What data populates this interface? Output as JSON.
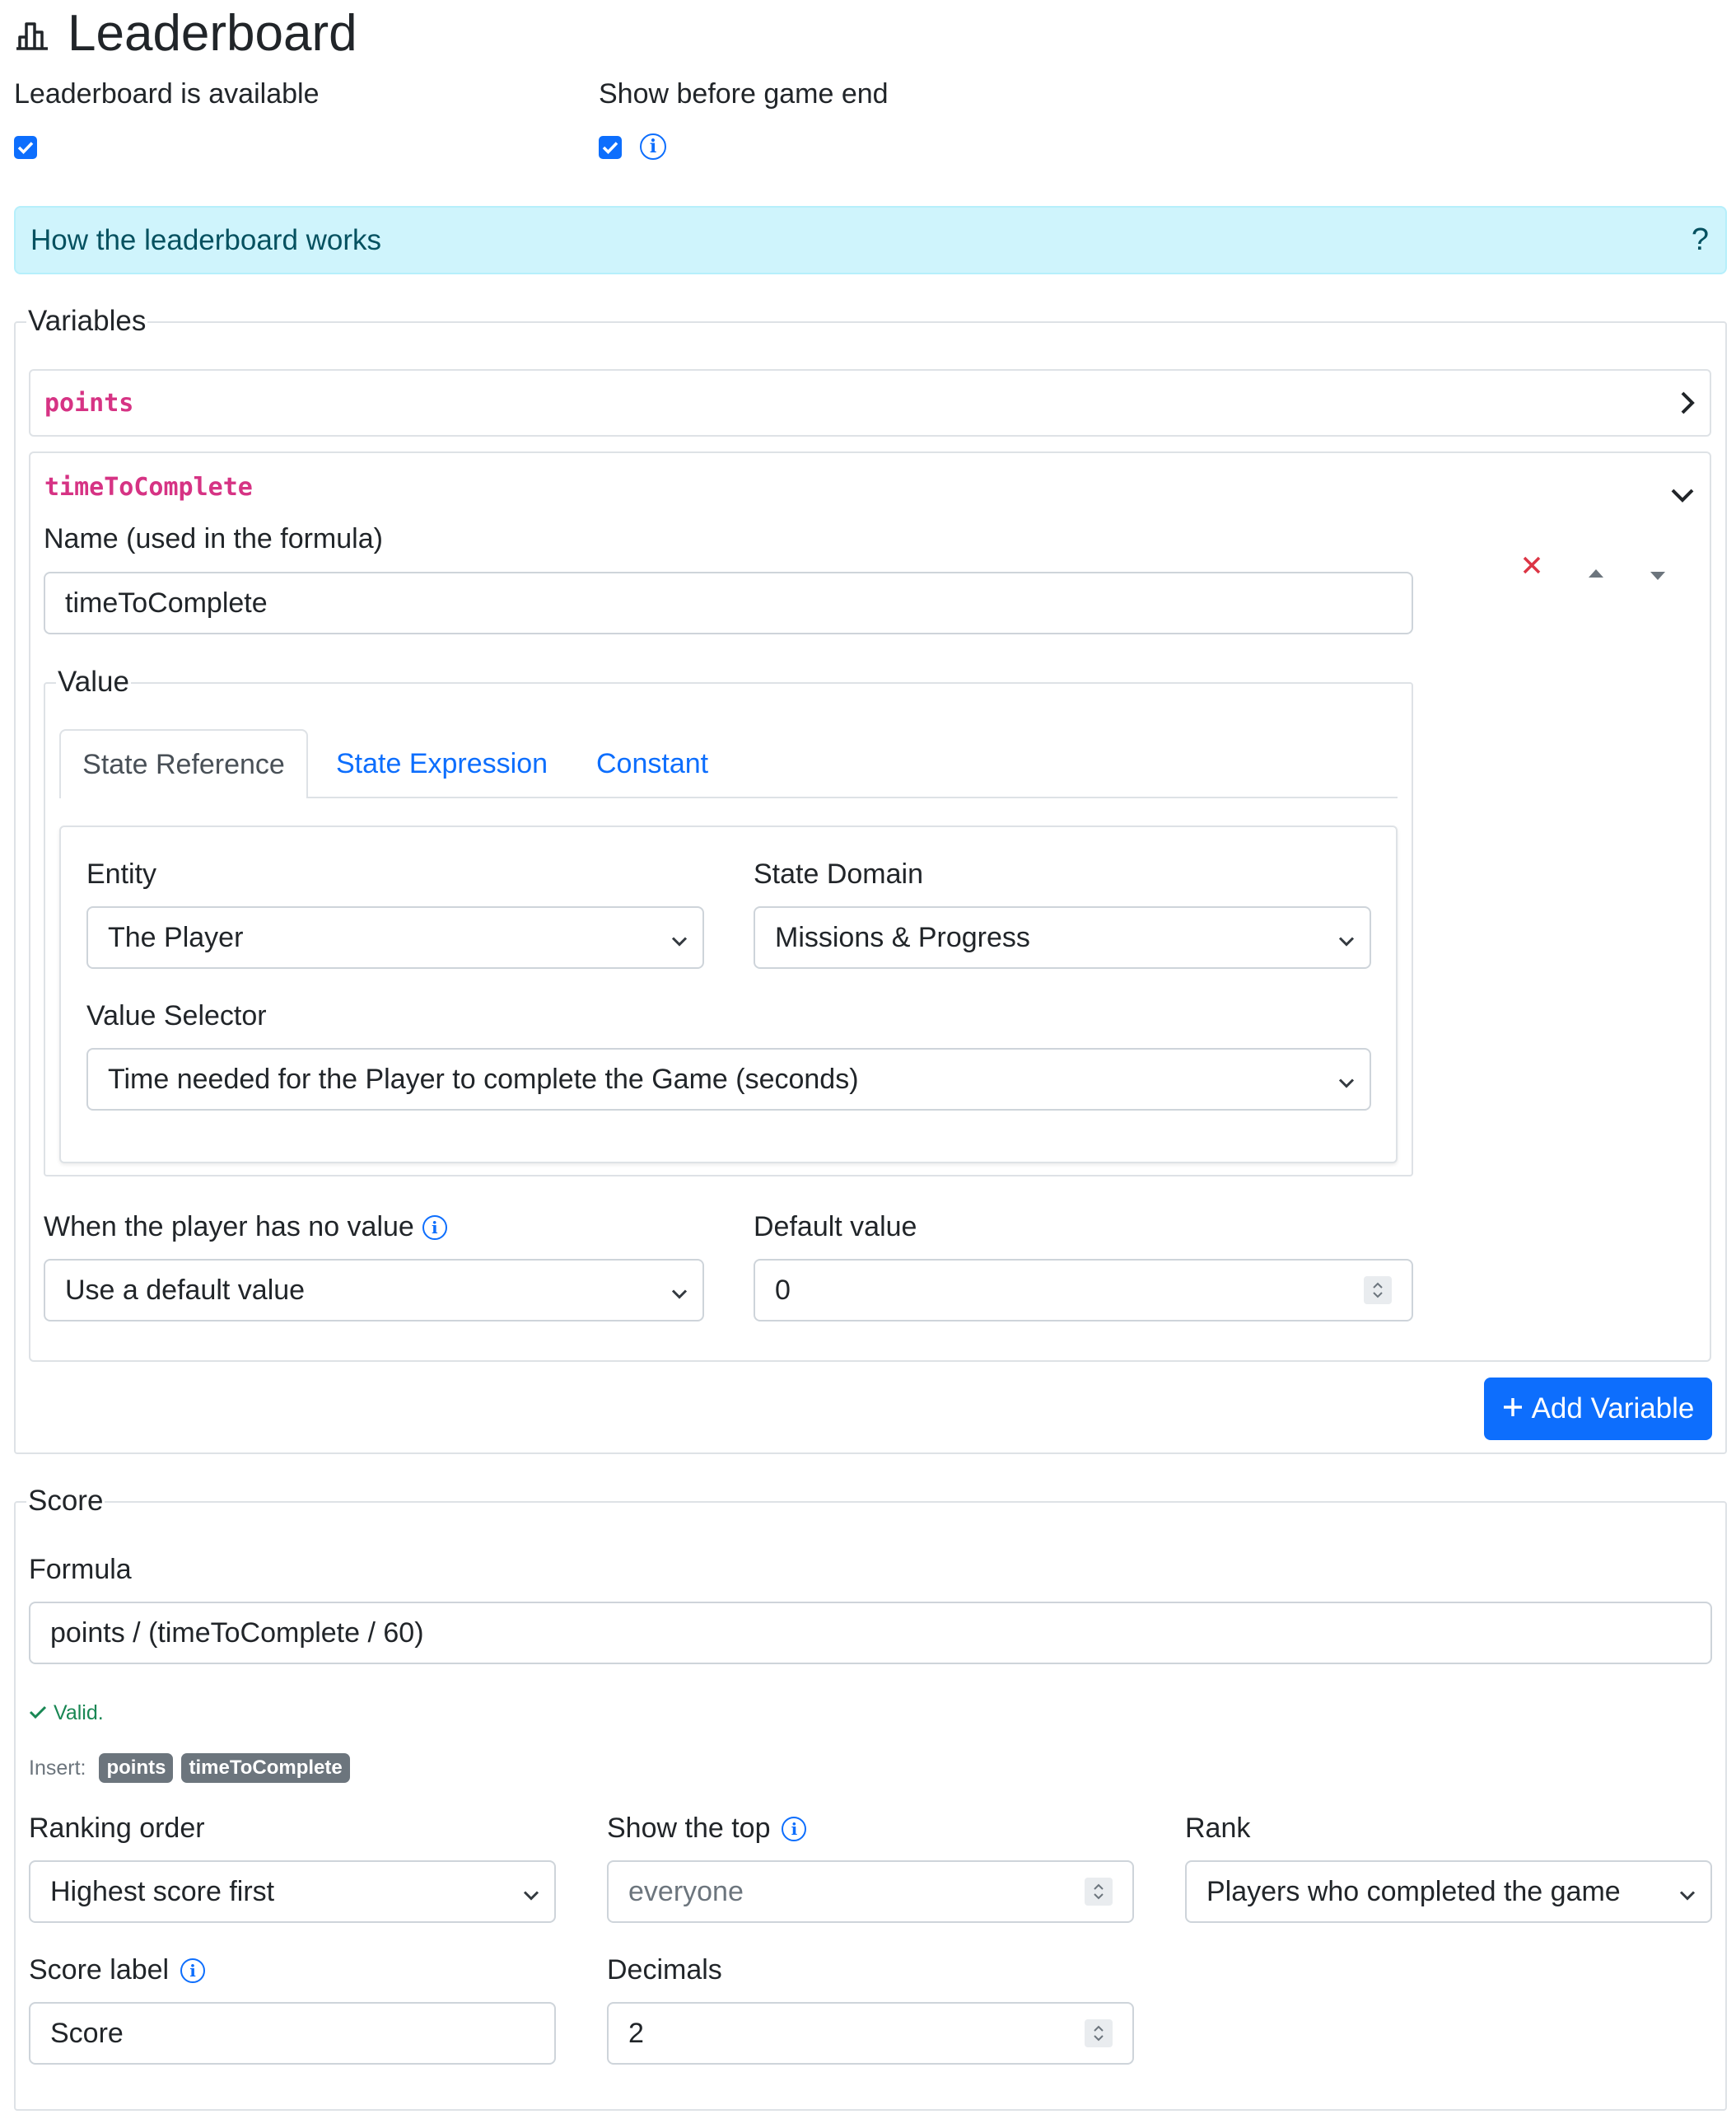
{
  "header": {
    "title": "Leaderboard",
    "icon": "bar-chart-icon"
  },
  "toggles": {
    "available_label": "Leaderboard is available",
    "available_checked": true,
    "show_before_end_label": "Show before game end",
    "show_before_end_checked": true
  },
  "info_alert": {
    "text": "How the leaderboard works",
    "toggle": "?"
  },
  "variables": {
    "legend": "Variables",
    "items": [
      {
        "name": "points",
        "expanded": false
      },
      {
        "name": "timeToComplete",
        "expanded": true
      }
    ],
    "editor": {
      "name_label": "Name (used in the formula)",
      "name_value": "timeToComplete",
      "value_legend": "Value",
      "tabs": [
        "State Reference",
        "State Expression",
        "Constant"
      ],
      "active_tab": "State Reference",
      "entity_label": "Entity",
      "entity_value": "The Player",
      "state_domain_label": "State Domain",
      "state_domain_value": "Missions & Progress",
      "value_selector_label": "Value Selector",
      "value_selector_value": "Time needed for the Player to complete the Game (seconds)",
      "no_value_label": "When the player has no value",
      "no_value_value": "Use a default value",
      "default_label": "Default value",
      "default_value": "0"
    },
    "add_button": "Add Variable"
  },
  "score": {
    "legend": "Score",
    "formula_label": "Formula",
    "formula_value": "points / (timeToComplete / 60)",
    "valid_text": "Valid.",
    "insert_label": "Insert:",
    "insert_badges": [
      "points",
      "timeToComplete"
    ],
    "ranking_label": "Ranking order",
    "ranking_value": "Highest score first",
    "show_top_label": "Show the top",
    "show_top_placeholder": "everyone",
    "rank_label": "Rank",
    "rank_value": "Players who completed the game",
    "score_label_label": "Score label",
    "score_label_value": "Score",
    "decimals_label": "Decimals",
    "decimals_value": "2"
  },
  "colors": {
    "primary": "#0d6efd",
    "code": "#d63384",
    "danger": "#dc3545",
    "success": "#198754",
    "alert_bg": "#cff4fc"
  }
}
